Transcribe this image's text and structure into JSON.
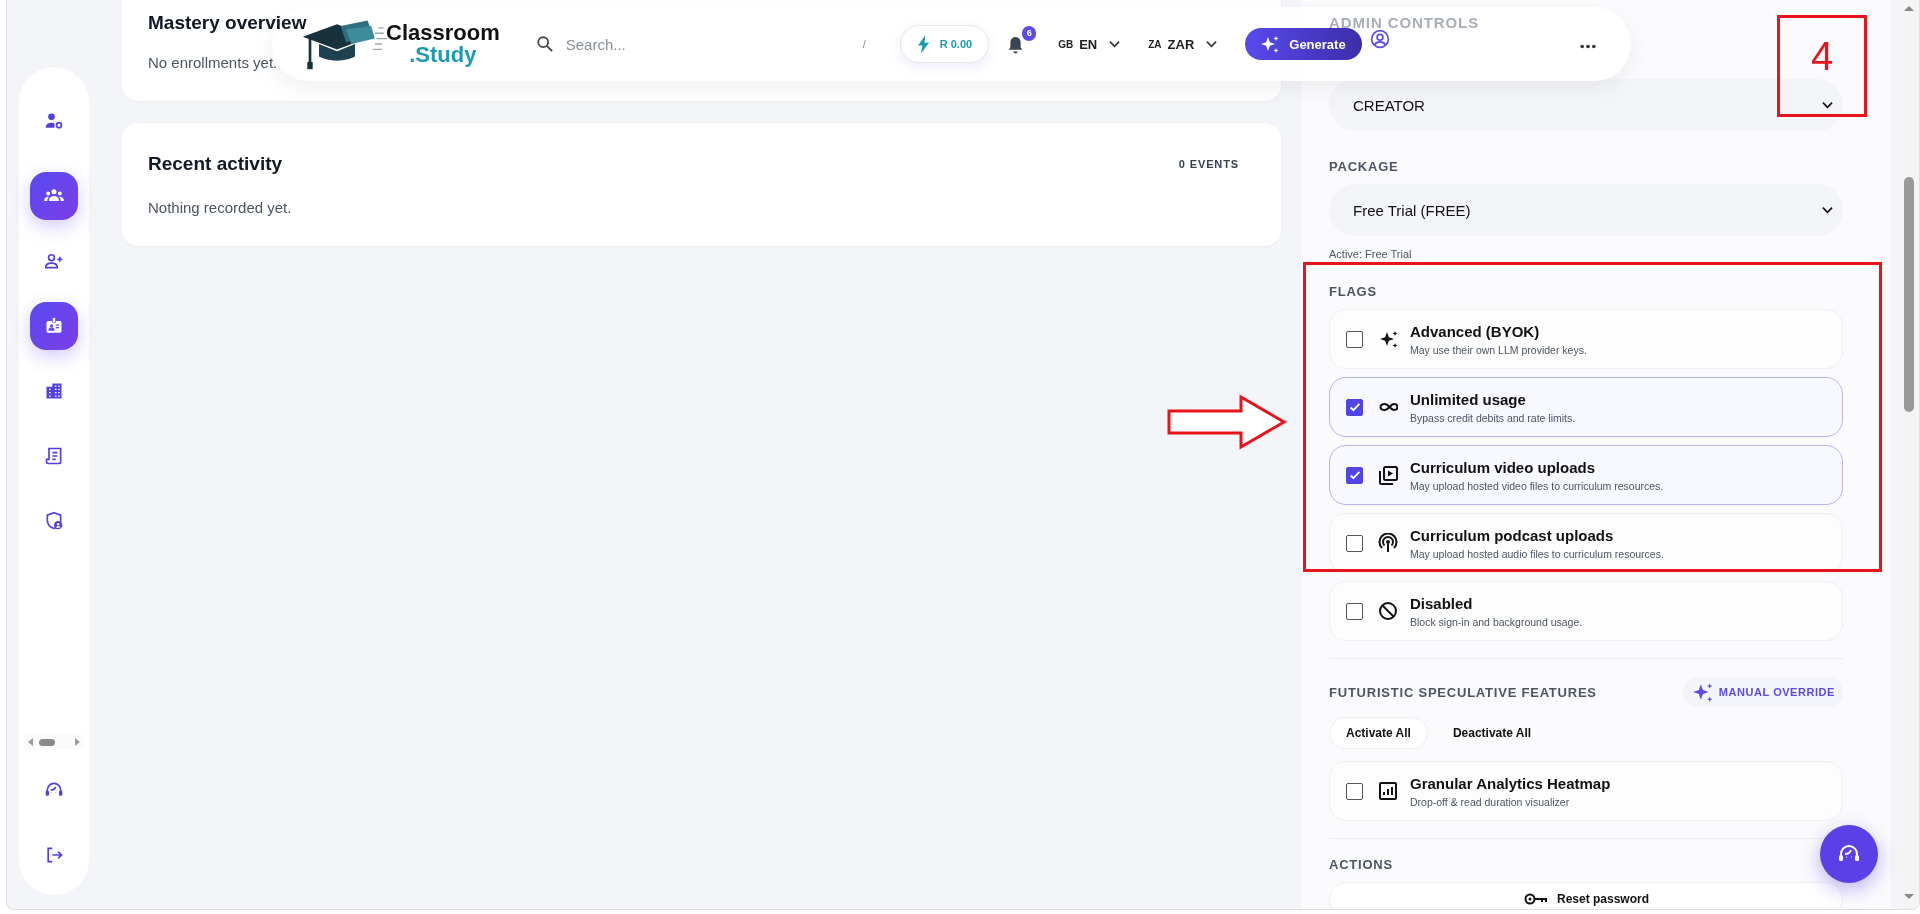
{
  "header": {
    "logo_top": "Classroom",
    "logo_bottom": ".Study",
    "search": {
      "placeholder": "Search...",
      "shortcut": "/"
    },
    "credits": "R 0.00",
    "notifications": {
      "count": "6"
    },
    "language": {
      "flag": "GB",
      "code": "EN"
    },
    "currency": {
      "flag": "ZA",
      "code": "ZAR"
    },
    "generate_button": "Generate"
  },
  "sidebar": {
    "items": [
      {
        "kind": "user-settings",
        "selected": false
      },
      {
        "kind": "group",
        "selected": true
      },
      {
        "kind": "user-add",
        "selected": false
      },
      {
        "kind": "badge",
        "selected": true
      },
      {
        "kind": "building",
        "selected": false
      },
      {
        "kind": "receipt",
        "selected": false
      },
      {
        "kind": "shield",
        "selected": false
      }
    ],
    "footer": [
      {
        "kind": "support"
      },
      {
        "kind": "logout"
      }
    ]
  },
  "cards": [
    {
      "title": "Mastery overview",
      "body": "No enrollments yet."
    },
    {
      "title": "Recent activity",
      "count": "0 EVENTS",
      "body": "Nothing recorded yet."
    }
  ],
  "admin_panel": {
    "title": "ADMIN CONTROLS",
    "role": {
      "value": "CREATOR"
    },
    "package": {
      "label": "PACKAGE",
      "value": "Free Trial (FREE)",
      "note": "Active: Free Trial"
    },
    "flags": {
      "label": "FLAGS",
      "items": [
        {
          "kind": "sparkle",
          "title": "Advanced (BYOK)",
          "description": "May use their own LLM provider keys.",
          "checked": false
        },
        {
          "kind": "infinity",
          "title": "Unlimited usage",
          "description": "Bypass credit debits and rate limits.",
          "checked": true
        },
        {
          "kind": "video",
          "title": "Curriculum video uploads",
          "description": "May upload hosted video files to curriculum resources.",
          "checked": true
        },
        {
          "kind": "podcast",
          "title": "Curriculum podcast uploads",
          "description": "May upload hosted audio files to curriculum resources.",
          "checked": false
        },
        {
          "kind": "block",
          "title": "Disabled",
          "description": "Block sign-in and background usage.",
          "checked": false
        }
      ]
    },
    "futuristic": {
      "label": "FUTURISTIC SPECULATIVE FEATURES",
      "badge": "MANUAL OVERRIDE",
      "activate_all": "Activate All",
      "deactivate_all": "Deactivate All",
      "items": [
        {
          "kind": "chart",
          "title": "Granular Analytics Heatmap",
          "description": "Drop-off & read duration visualizer",
          "checked": false
        }
      ]
    },
    "actions": {
      "label": "ACTIONS",
      "buttons": [
        {
          "kind": "key",
          "label": "Reset password"
        }
      ]
    }
  },
  "annotation": {
    "step_number": "4"
  }
}
